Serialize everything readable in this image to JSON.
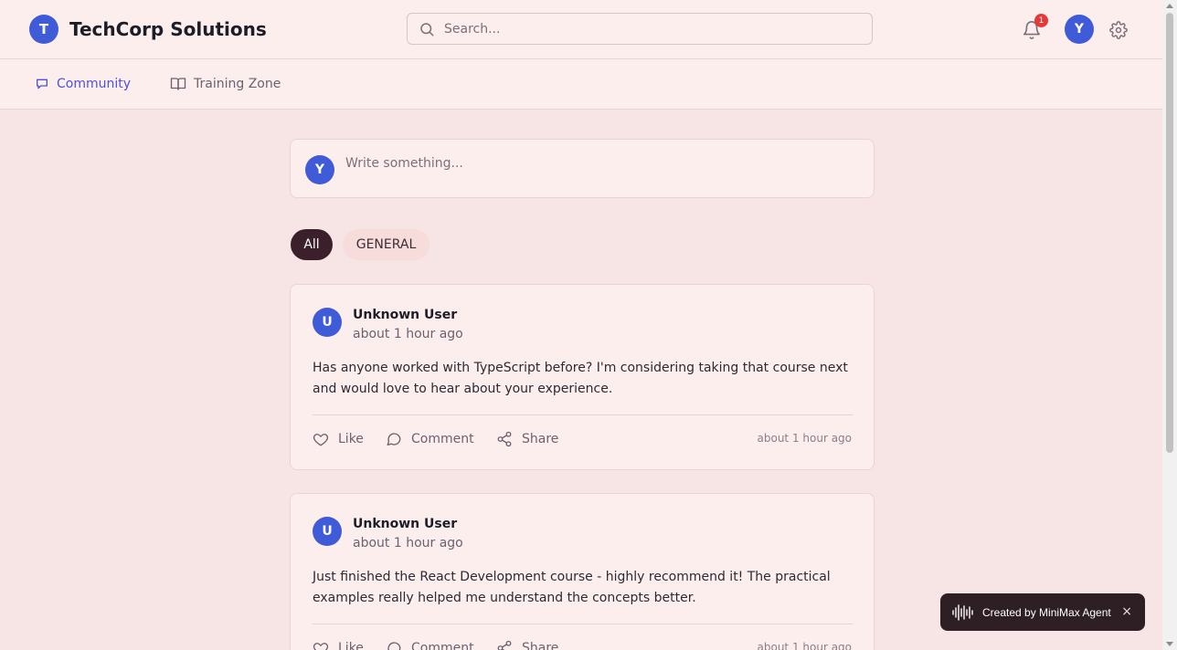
{
  "header": {
    "logo_letter": "T",
    "brand": "TechCorp Solutions",
    "search_placeholder": "Search...",
    "notification_count": "1",
    "user_initial": "Y"
  },
  "nav": {
    "tabs": [
      {
        "label": "Community",
        "icon": "chat-icon",
        "active": true
      },
      {
        "label": "Training Zone",
        "icon": "book-icon",
        "active": false
      }
    ]
  },
  "composer": {
    "user_initial": "Y",
    "placeholder": "Write something..."
  },
  "filters": [
    {
      "label": "All",
      "active": true
    },
    {
      "label": "GENERAL",
      "active": false
    }
  ],
  "posts": [
    {
      "initial": "U",
      "author": "Unknown User",
      "time": "about 1 hour ago",
      "body": "Has anyone worked with TypeScript before? I'm considering taking that course next and would love to hear about your experience.",
      "like_label": "Like",
      "comment_label": "Comment",
      "share_label": "Share",
      "stamp": "about 1 hour ago"
    },
    {
      "initial": "U",
      "author": "Unknown User",
      "time": "about 1 hour ago",
      "body": "Just finished the React Development course - highly recommend it! The practical examples really helped me understand the concepts better.",
      "like_label": "Like",
      "comment_label": "Comment",
      "share_label": "Share",
      "stamp": "about 1 hour ago"
    }
  ],
  "toast": {
    "label": "Created by MiniMax Agent",
    "close": "×",
    "icon": "waveform-icon"
  },
  "colors": {
    "accent": "#3f5bd8",
    "active_tab": "#4c52d6",
    "chip_active_bg": "#3b1f2b",
    "badge": "#e23a3a",
    "page_bg": "#f7e4e4",
    "card_bg": "#fdeeee"
  }
}
